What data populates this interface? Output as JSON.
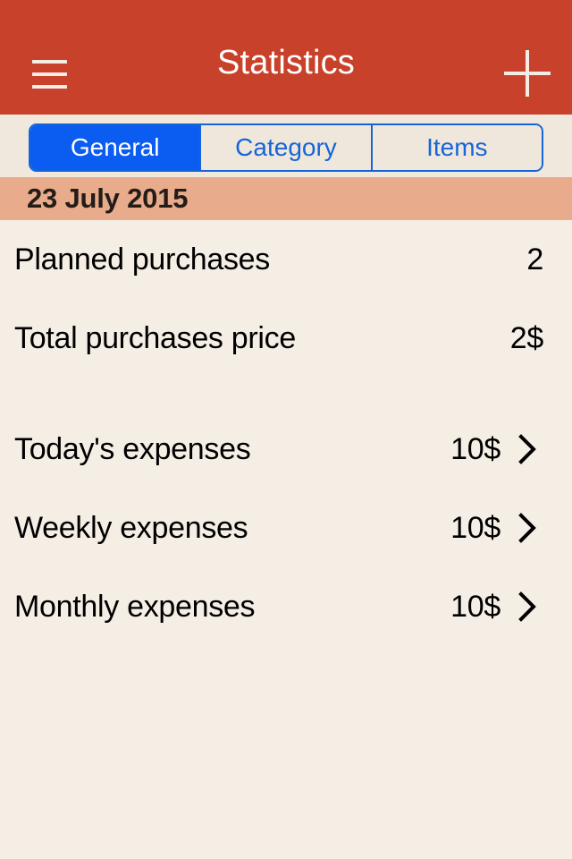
{
  "navbar": {
    "title": "Statistics",
    "menu_icon": "hamburger-menu-icon",
    "add_icon": "plus-icon",
    "background_color": "#c8412a",
    "title_color": "#ffffff"
  },
  "segmented_control": {
    "selected_index": 0,
    "accent_color": "#0b5cf0",
    "segments": [
      {
        "label": "General",
        "selected": true
      },
      {
        "label": "Category",
        "selected": false
      },
      {
        "label": "Items",
        "selected": false
      }
    ]
  },
  "date_header": {
    "text": "23 July 2015",
    "background_color": "#e8ab8b",
    "text_color": "#231c17"
  },
  "summary_rows": [
    {
      "label": "Planned purchases",
      "value": "2"
    },
    {
      "label": "Total purchases price",
      "value": "2$"
    }
  ],
  "expense_rows": [
    {
      "label": "Today's expenses",
      "value": "10$",
      "chevron": "chevron-right-icon"
    },
    {
      "label": "Weekly expenses",
      "value": "10$",
      "chevron": "chevron-right-icon"
    },
    {
      "label": "Monthly expenses",
      "value": "10$",
      "chevron": "chevron-right-icon"
    }
  ],
  "background_color": "#f5eee5"
}
